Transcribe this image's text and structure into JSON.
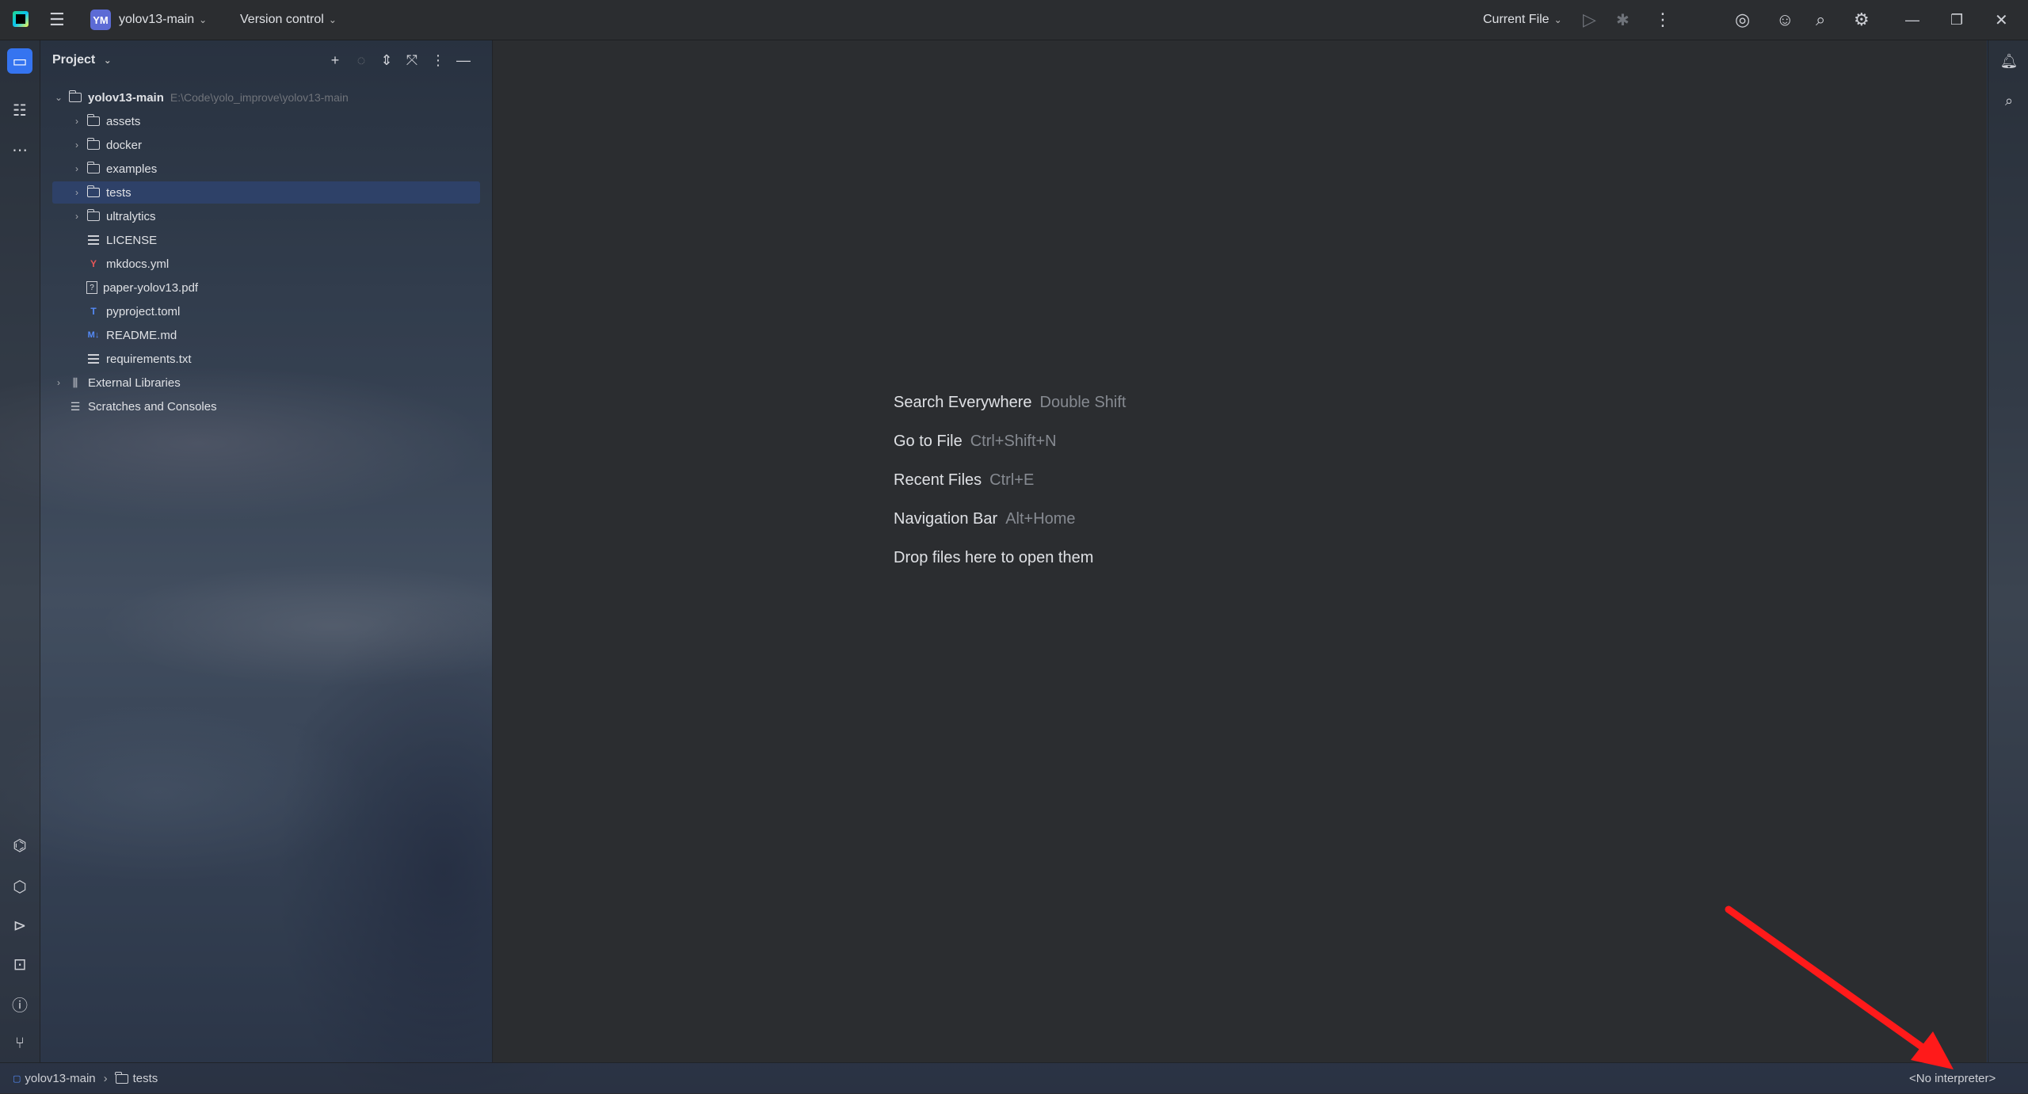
{
  "titlebar": {
    "project_badge": "YM",
    "project_name": "yolov13-main",
    "vcs_label": "Version control",
    "run_config": "Current File"
  },
  "project_panel": {
    "title": "Project",
    "root": {
      "name": "yolov13-main",
      "path": "E:\\Code\\yolo_improve\\yolov13-main"
    },
    "items": [
      {
        "name": "assets",
        "kind": "folder"
      },
      {
        "name": "docker",
        "kind": "folder"
      },
      {
        "name": "examples",
        "kind": "folder"
      },
      {
        "name": "tests",
        "kind": "test-folder",
        "selected": true
      },
      {
        "name": "ultralytics",
        "kind": "package"
      },
      {
        "name": "LICENSE",
        "kind": "text"
      },
      {
        "name": "mkdocs.yml",
        "kind": "yaml"
      },
      {
        "name": "paper-yolov13.pdf",
        "kind": "unknown"
      },
      {
        "name": "pyproject.toml",
        "kind": "toml"
      },
      {
        "name": "README.md",
        "kind": "markdown"
      },
      {
        "name": "requirements.txt",
        "kind": "text"
      }
    ],
    "external_libraries": "External Libraries",
    "scratches": "Scratches and Consoles"
  },
  "editor_hints": [
    {
      "action": "Search Everywhere",
      "shortcut": "Double Shift"
    },
    {
      "action": "Go to File",
      "shortcut": "Ctrl+Shift+N"
    },
    {
      "action": "Recent Files",
      "shortcut": "Ctrl+E"
    },
    {
      "action": "Navigation Bar",
      "shortcut": "Alt+Home"
    },
    {
      "action": "Drop files here to open them",
      "shortcut": ""
    }
  ],
  "statusbar": {
    "breadcrumb_project": "yolov13-main",
    "breadcrumb_folder": "tests",
    "interpreter": "<No interpreter>"
  },
  "colors": {
    "accent": "#3574f0",
    "selection": "#2e436e",
    "annotation_arrow": "#ff1a1a"
  }
}
